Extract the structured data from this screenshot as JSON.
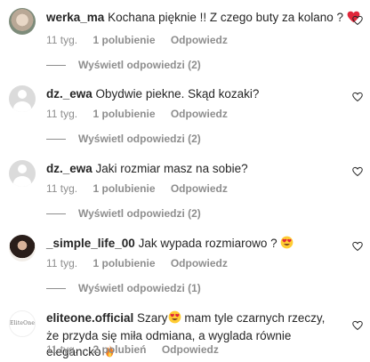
{
  "comments": [
    {
      "username": "werka_ma",
      "text": "Kochana pięknie !! Z czego buty za kolano ?",
      "time": "11 tyg.",
      "likes": "1 polubienie",
      "reply_label": "Odpowiedz",
      "replies_label": "Wyświetl odpowiedzi (2)",
      "avatar": "user-photo",
      "emoji": "red-heart"
    },
    {
      "username": "dz._ewa",
      "text": "Obydwie piekne. Skąd kozaki?",
      "time": "11 tyg.",
      "likes": "1 polubienie",
      "reply_label": "Odpowiedz",
      "replies_label": "Wyświetl odpowiedzi (2)",
      "avatar": "default-avatar"
    },
    {
      "username": "dz._ewa",
      "text": "Jaki rozmiar masz na sobie?",
      "time": "11 tyg.",
      "likes": "1 polubienie",
      "reply_label": "Odpowiedz",
      "replies_label": "Wyświetl odpowiedzi (2)",
      "avatar": "default-avatar"
    },
    {
      "username": "_simple_life_00",
      "text": "Jak wypada rozmiarowo ?",
      "time": "11 tyg.",
      "likes": "1 polubienie",
      "reply_label": "Odpowiedz",
      "replies_label": "Wyświetl odpowiedzi (1)",
      "avatar": "user-photo",
      "emoji": "heart-eyes"
    },
    {
      "username": "eliteone.official",
      "text_a": "Szary",
      "text_b": "mam tyle czarnych rzeczy, że przyda się miła odmiana, a wyglada równie elegancko",
      "time": "11 tyg.",
      "likes": "2 polubień",
      "reply_label": "Odpowiedz",
      "avatar": "brand-logo",
      "avatar_logo": "EliteOne",
      "emoji_a": "heart-eyes",
      "emoji_b": "fire"
    }
  ],
  "colors": {
    "text": "#262626",
    "secondary": "#8e8e8e",
    "heart": "#ed4956",
    "avatar_placeholder": "#dbdbdb"
  }
}
